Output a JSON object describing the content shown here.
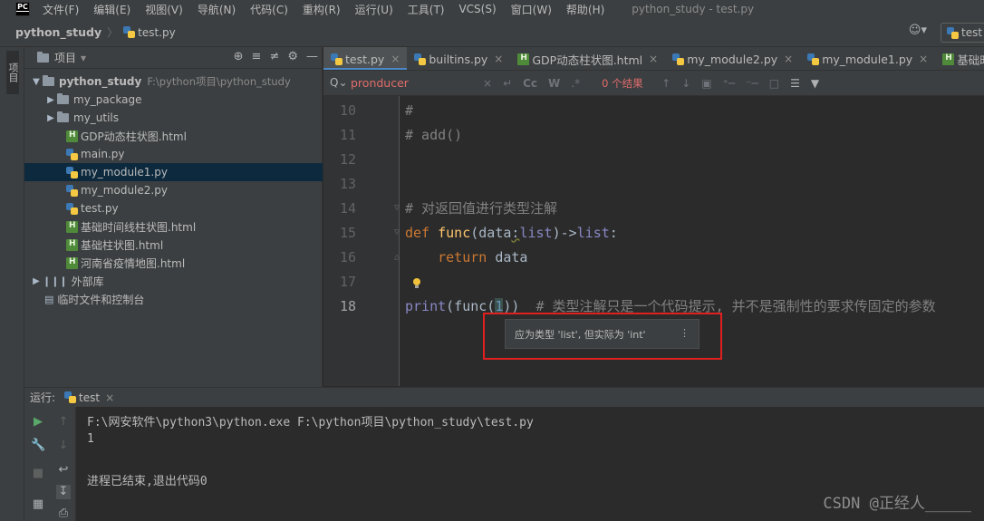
{
  "menubar": {
    "logo": "PC",
    "items": [
      "文件(F)",
      "编辑(E)",
      "视图(V)",
      "导航(N)",
      "代码(C)",
      "重构(R)",
      "运行(U)",
      "工具(T)",
      "VCS(S)",
      "窗口(W)",
      "帮助(H)"
    ],
    "window_title": "python_study - test.py"
  },
  "breadcrumb": {
    "project": "python_study",
    "file": "test.py"
  },
  "toolbar": {
    "run_config": "test"
  },
  "left_stripe": {
    "project_label": "项目"
  },
  "project_panel": {
    "title": "项目",
    "root": {
      "name": "python_study",
      "path": "F:\\python项目\\python_study"
    },
    "items": [
      {
        "name": "my_package",
        "type": "folder"
      },
      {
        "name": "my_utils",
        "type": "folder"
      },
      {
        "name": "GDP动态柱状图.html",
        "type": "html"
      },
      {
        "name": "main.py",
        "type": "py"
      },
      {
        "name": "my_module1.py",
        "type": "py",
        "selected": true
      },
      {
        "name": "my_module2.py",
        "type": "py"
      },
      {
        "name": "test.py",
        "type": "py"
      },
      {
        "name": "基础时间线柱状图.html",
        "type": "html"
      },
      {
        "name": "基础柱状图.html",
        "type": "html"
      },
      {
        "name": "河南省疫情地图.html",
        "type": "html"
      }
    ],
    "external_libs": "外部库",
    "scratches": "临时文件和控制台"
  },
  "tabs": [
    {
      "label": "test.py",
      "type": "py",
      "active": true
    },
    {
      "label": "builtins.py",
      "type": "py"
    },
    {
      "label": "GDP动态柱状图.html",
      "type": "html"
    },
    {
      "label": "my_module2.py",
      "type": "py"
    },
    {
      "label": "my_module1.py",
      "type": "py"
    },
    {
      "label": "基础时间线柱",
      "type": "html"
    }
  ],
  "find": {
    "query": "pronducer",
    "result": "0 个结果",
    "case_label": "Cc",
    "word_label": "W",
    "regex_label": ".*"
  },
  "editor": {
    "lines": [
      {
        "num": "10",
        "text": "#"
      },
      {
        "num": "11",
        "text": "# add()"
      },
      {
        "num": "12",
        "text": ""
      },
      {
        "num": "13",
        "text": ""
      },
      {
        "num": "14",
        "text": "# 对返回值进行类型注解"
      },
      {
        "num": "15",
        "kw1": "def ",
        "fn": "func",
        "p1": "(data",
        "p2": ":",
        "bi1": "list",
        "p3": ")->",
        "bi2": "list",
        "p4": ":"
      },
      {
        "num": "16",
        "kw1": "    return ",
        "p1": "data"
      },
      {
        "num": "17",
        "text": ""
      },
      {
        "num": "18",
        "bi1": "print",
        "p1": "(func(",
        "num_lit": "1",
        "p2": "))  ",
        "comment": "# 类型注解只是一个代码提示, 并不是强制性的要求传固定的参数"
      }
    ],
    "tooltip": "应为类型 'list', 但实际为 'int'"
  },
  "run": {
    "label": "运行:",
    "tab": "test",
    "console": [
      "F:\\网安软件\\python3\\python.exe F:\\python项目\\python_study\\test.py",
      "1",
      "",
      "进程已结束,退出代码0"
    ]
  },
  "watermark": "CSDN @正经人_____",
  "colors": {
    "background": "#2b2b2b",
    "panel": "#3c3f41",
    "keyword": "#cc7832",
    "function": "#ffc66d",
    "comment": "#808080",
    "builtin": "#8888c6",
    "highlight_box": "#e0201f",
    "search_no_match": "#e06c6c"
  }
}
